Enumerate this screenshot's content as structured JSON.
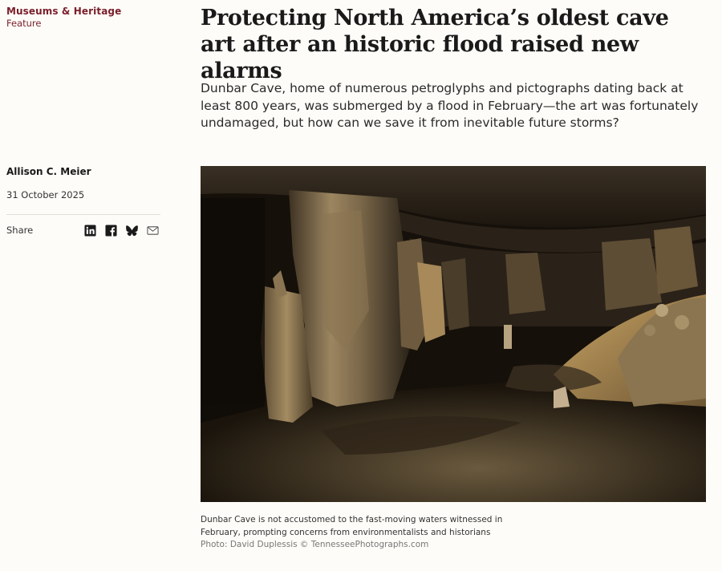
{
  "kicker": {
    "section": "Museums & Heritage",
    "type": "Feature"
  },
  "article": {
    "headline": "Protecting North America’s oldest cave art after an historic flood raised new alarms",
    "dek": "Dunbar Cave, home of numerous petroglyphs and pictographs dating back at least 800 years, was submerged by a flood in February—the art was fortunately undamaged, but how can we save it from inevitable future storms?",
    "author": "Allison C. Meier",
    "date": "31 October 2025"
  },
  "share": {
    "label": "Share",
    "icons": [
      "linkedin-icon",
      "facebook-icon",
      "bluesky-icon",
      "email-icon"
    ]
  },
  "figure": {
    "caption": "Dunbar Cave is not accustomed to the fast-moving waters witnessed in February, prompting concerns from environmentalists and historians",
    "credit": "Photo: David Duplessis © TennesseePhotographs.com"
  },
  "colors": {
    "accent": "#7a1f2b",
    "background": "#fdfcf8",
    "text": "#1a1a1a"
  }
}
